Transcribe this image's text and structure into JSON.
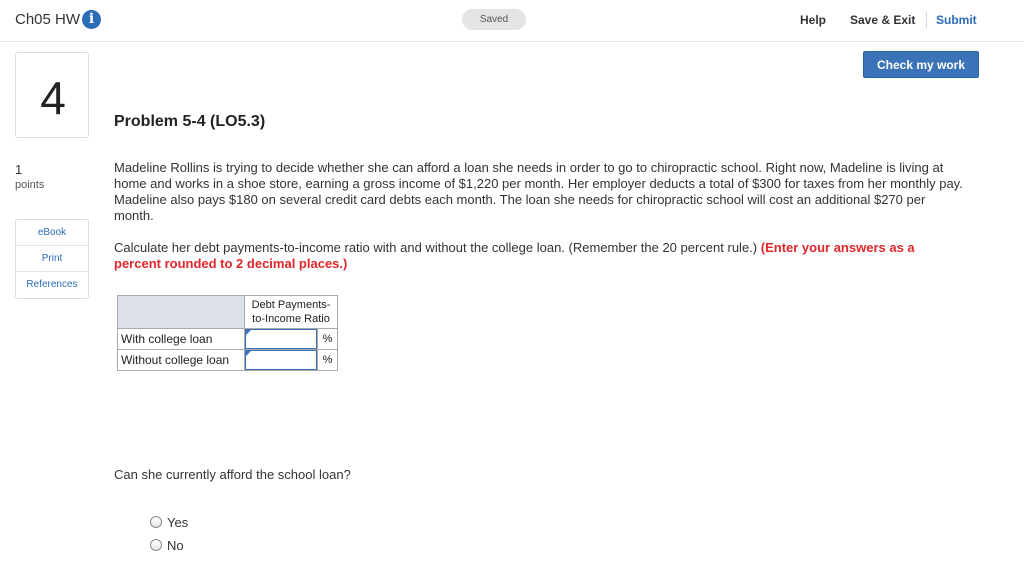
{
  "header": {
    "title": "Ch05 HW",
    "info_glyph": "i",
    "saved": "Saved",
    "help": "Help",
    "save_exit": "Save & Exit",
    "submit": "Submit"
  },
  "check_button": "Check my work",
  "question": {
    "number": "4",
    "points_value": "1",
    "points_label": "points"
  },
  "sidebar": {
    "items": [
      {
        "label": "eBook"
      },
      {
        "label": "Print"
      },
      {
        "label": "References"
      }
    ]
  },
  "problem": {
    "title": "Problem 5-4 (LO5.3)",
    "text": "Madeline Rollins is trying to decide whether she can afford a loan she needs in order to go to chiropractic school. Right now, Madeline is living at home and works in a shoe store, earning a gross income of $1,220 per month. Her employer deducts a total of $300 for taxes from her monthly pay. Madeline also pays $180 on several credit card debts each month. The loan she needs for chiropractic school will cost an additional $270 per month.",
    "instruction": "Calculate her debt payments-to-income ratio with and without the college loan. (Remember the 20 percent rule.)",
    "instruction_red": "(Enter your answers as a percent rounded to 2 decimal places.)"
  },
  "table": {
    "header_line1": "Debt Payments-",
    "header_line2": "to-Income Ratio",
    "rows": [
      {
        "label": "With college loan",
        "value": "",
        "unit": "%"
      },
      {
        "label": "Without college loan",
        "value": "",
        "unit": "%"
      }
    ]
  },
  "question2": {
    "text": "Can she currently afford the school loan?",
    "options": [
      {
        "label": "Yes"
      },
      {
        "label": "No"
      }
    ]
  },
  "colors": {
    "accent": "#3a73b8",
    "link": "#2b6cb6",
    "warning": "#e0262b"
  }
}
